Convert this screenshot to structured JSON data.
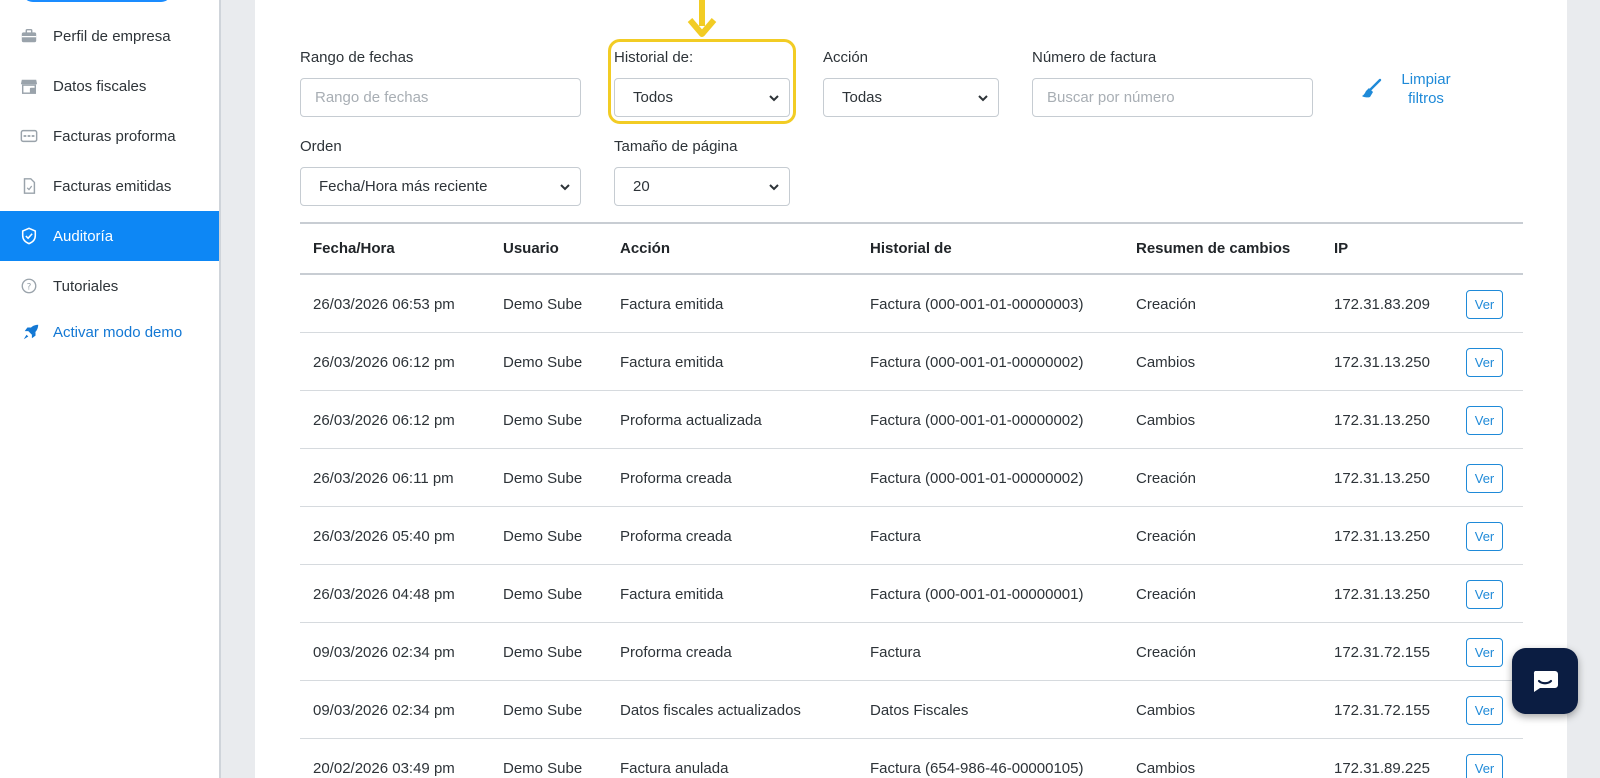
{
  "sidebar": {
    "items": [
      {
        "label": "Perfil de empresa",
        "icon": "briefcase-icon"
      },
      {
        "label": "Datos fiscales",
        "icon": "store-icon"
      },
      {
        "label": "Facturas proforma",
        "icon": "card-icon"
      },
      {
        "label": "Facturas emitidas",
        "icon": "document-icon"
      },
      {
        "label": "Auditoría",
        "icon": "shield-check-icon",
        "active": true
      },
      {
        "label": "Tutoriales",
        "icon": "help-circle-icon"
      }
    ],
    "demo_label": "Activar modo demo",
    "demo_icon": "rocket-icon",
    "active_color": "#0d87f5"
  },
  "filters": {
    "date_range": {
      "label": "Rango de fechas",
      "placeholder": "Rango de fechas"
    },
    "history": {
      "label": "Historial de:",
      "value": "Todos"
    },
    "action": {
      "label": "Acción",
      "value": "Todas"
    },
    "invoice_number": {
      "label": "Número de factura",
      "placeholder": "Buscar por número"
    },
    "clear_label": "Limpiar filtros",
    "order": {
      "label": "Orden",
      "value": "Fecha/Hora más reciente"
    },
    "page_size": {
      "label": "Tamaño de página",
      "value": "20"
    }
  },
  "highlight_color": "#f2cc24",
  "table": {
    "headers": [
      "Fecha/Hora",
      "Usuario",
      "Acción",
      "Historial de",
      "Resumen de cambios",
      "IP"
    ],
    "view_label": "Ver",
    "rows": [
      [
        "26/03/2026 06:53 pm",
        "Demo Sube",
        "Factura emitida",
        "Factura (000-001-01-00000003)",
        "Creación",
        "172.31.83.209"
      ],
      [
        "26/03/2026 06:12 pm",
        "Demo Sube",
        "Factura emitida",
        "Factura (000-001-01-00000002)",
        "Cambios",
        "172.31.13.250"
      ],
      [
        "26/03/2026 06:12 pm",
        "Demo Sube",
        "Proforma actualizada",
        "Factura (000-001-01-00000002)",
        "Cambios",
        "172.31.13.250"
      ],
      [
        "26/03/2026 06:11 pm",
        "Demo Sube",
        "Proforma creada",
        "Factura (000-001-01-00000002)",
        "Creación",
        "172.31.13.250"
      ],
      [
        "26/03/2026 05:40 pm",
        "Demo Sube",
        "Proforma creada",
        "Factura",
        "Creación",
        "172.31.13.250"
      ],
      [
        "26/03/2026 04:48 pm",
        "Demo Sube",
        "Factura emitida",
        "Factura (000-001-01-00000001)",
        "Creación",
        "172.31.13.250"
      ],
      [
        "09/03/2026 02:34 pm",
        "Demo Sube",
        "Proforma creada",
        "Factura",
        "Creación",
        "172.31.72.155"
      ],
      [
        "09/03/2026 02:34 pm",
        "Demo Sube",
        "Datos fiscales actualizados",
        "Datos Fiscales",
        "Cambios",
        "172.31.72.155"
      ],
      [
        "20/02/2026 03:49 pm",
        "Demo Sube",
        "Factura anulada",
        "Factura (654-986-46-00000105)",
        "Cambios",
        "172.31.89.225"
      ]
    ]
  }
}
